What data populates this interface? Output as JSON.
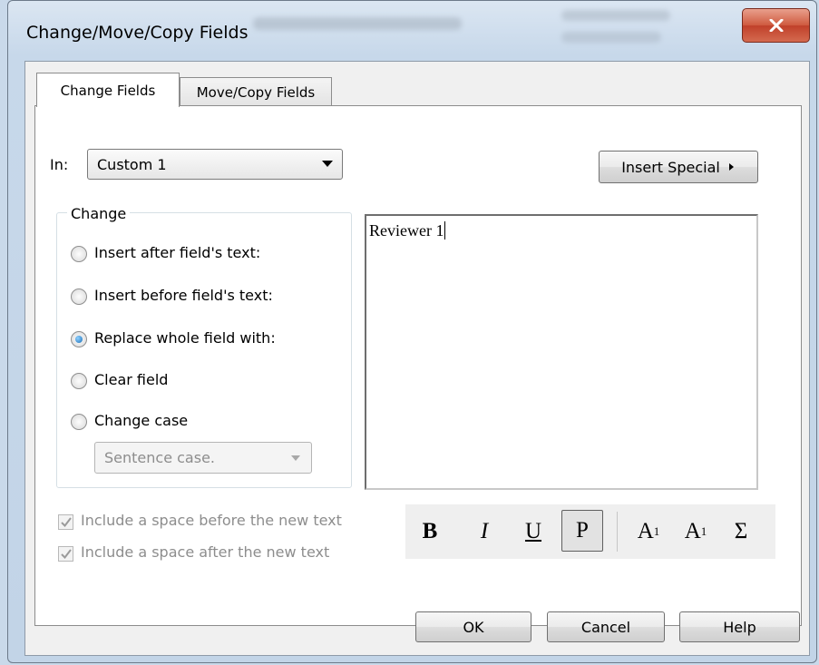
{
  "window": {
    "title": "Change/Move/Copy Fields"
  },
  "tabs": [
    {
      "label": "Change Fields"
    },
    {
      "label": "Move/Copy Fields"
    }
  ],
  "in_field": {
    "label": "In:",
    "value": "Custom 1"
  },
  "insert_special": {
    "label": "Insert Special"
  },
  "change_group": {
    "legend": "Change",
    "options": [
      {
        "label": "Insert after field's text:",
        "selected": false
      },
      {
        "label": "Insert before field's text:",
        "selected": false
      },
      {
        "label": "Replace whole field with:",
        "selected": true
      },
      {
        "label": "Clear field",
        "selected": false
      },
      {
        "label": "Change case",
        "selected": false
      }
    ],
    "case_select": {
      "value": "Sentence case."
    }
  },
  "text_area": {
    "value": "Reviewer 1"
  },
  "checkboxes": [
    {
      "label": "Include a space before the new text",
      "checked": true,
      "disabled": true
    },
    {
      "label": "Include a space after the new text",
      "checked": true,
      "disabled": true
    }
  ],
  "format_toolbar": {
    "bold": "B",
    "italic": "I",
    "underline": "U",
    "plain": "P",
    "superscript": "A",
    "superscript_mark": "1",
    "subscript": "A",
    "subscript_mark": "1",
    "symbol": "Σ"
  },
  "buttons": {
    "ok": "OK",
    "cancel": "Cancel",
    "help": "Help"
  },
  "colors": {
    "title_bar": "#c7d8ea",
    "close_button": "#c0402a",
    "selected_radio": "#1c6fb8"
  }
}
